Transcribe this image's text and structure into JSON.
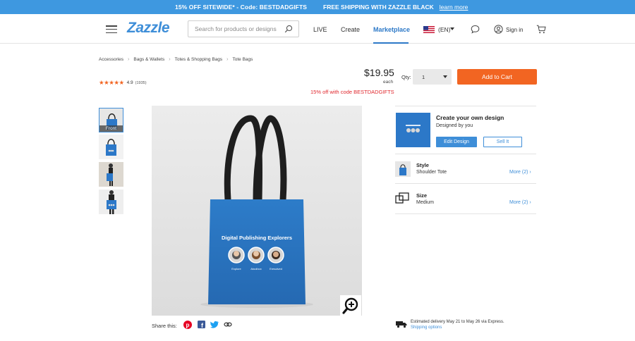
{
  "promo": {
    "left": "15% OFF SITEWIDE* - Code: BESTDADGIFTS",
    "right": "FREE SHIPPING WITH ZAZZLE BLACK",
    "link": "learn more"
  },
  "header": {
    "logo": "Zazzle",
    "search_placeholder": "Search for products or designs",
    "nav": {
      "live": "LIVE",
      "create": "Create",
      "marketplace": "Marketplace"
    },
    "lang": "(EN)",
    "signin": "Sign in"
  },
  "breadcrumb": [
    "Accessories",
    "Bags & Wallets",
    "Totes & Shopping Bags",
    "Tote Bags"
  ],
  "rating": {
    "stars": "★★★★★",
    "value": "4.9",
    "count": "(1935)"
  },
  "price": {
    "amount": "$19.95",
    "unit": "each",
    "discount": "15% off with code BESTDADGIFTS"
  },
  "qty": {
    "label": "Qty:",
    "value": "1"
  },
  "add_to_cart": "Add to Cart",
  "thumbs": {
    "front_label": "Front"
  },
  "product_image": {
    "title": "Digital Publishing Explorers",
    "captions": [
      "Explore",
      "Atoolbox",
      "Eresolved"
    ]
  },
  "share": {
    "label": "Share this:"
  },
  "design": {
    "title": "Create your own design",
    "subtitle": "Designed by you",
    "edit": "Edit Design",
    "sell": "Sell It"
  },
  "options": [
    {
      "title": "Style",
      "value": "Shoulder Tote",
      "more": "More (2) ›"
    },
    {
      "title": "Size",
      "value": "Medium",
      "more": "More (2) ›"
    }
  ],
  "delivery": {
    "text": "Estimated delivery May 21 to May 26 via Express.",
    "link": "Shipping options"
  },
  "colors": {
    "accent": "#3e8ed8",
    "cta": "#f26522",
    "promo": "#3e98e0",
    "tote": "#2c78c8"
  }
}
